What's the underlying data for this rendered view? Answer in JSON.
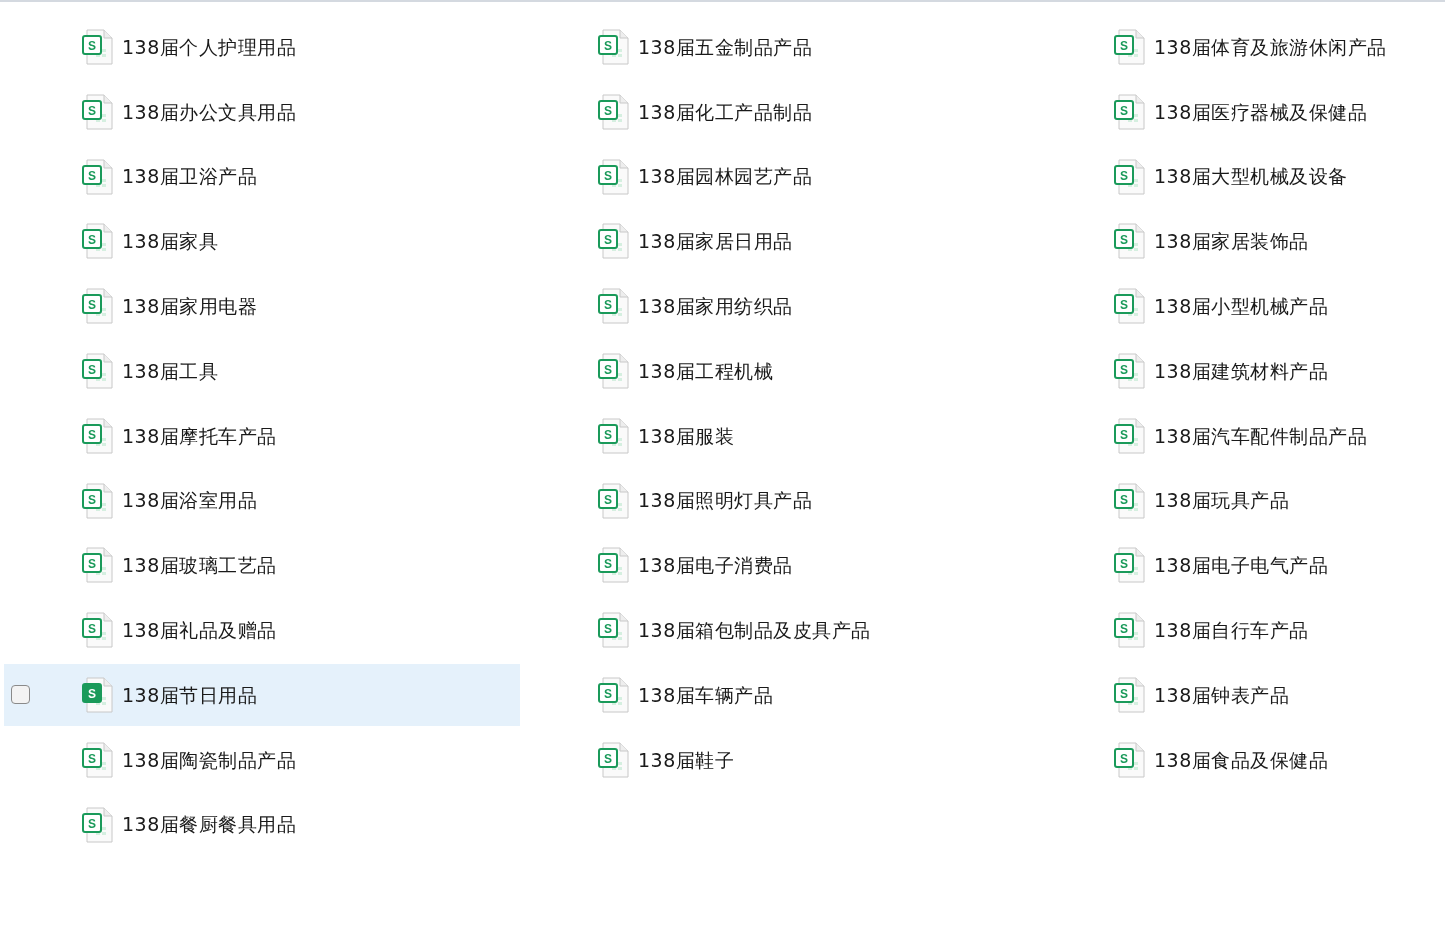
{
  "files": [
    {
      "icon_letter": "S",
      "name": "138届个人护理用品",
      "selected": false,
      "checked": false
    },
    {
      "icon_letter": "S",
      "name": "138届五金制品产品",
      "selected": false,
      "checked": false
    },
    {
      "icon_letter": "S",
      "name": "138届体育及旅游休闲产品",
      "selected": false,
      "checked": false
    },
    {
      "icon_letter": "S",
      "name": "138届办公文具用品",
      "selected": false,
      "checked": false
    },
    {
      "icon_letter": "S",
      "name": "138届化工产品制品",
      "selected": false,
      "checked": false
    },
    {
      "icon_letter": "S",
      "name": "138届医疗器械及保健品",
      "selected": false,
      "checked": false
    },
    {
      "icon_letter": "S",
      "name": "138届卫浴产品",
      "selected": false,
      "checked": false
    },
    {
      "icon_letter": "S",
      "name": "138届园林园艺产品",
      "selected": false,
      "checked": false
    },
    {
      "icon_letter": "S",
      "name": "138届大型机械及设备",
      "selected": false,
      "checked": false
    },
    {
      "icon_letter": "S",
      "name": "138届家具",
      "selected": false,
      "checked": false
    },
    {
      "icon_letter": "S",
      "name": "138届家居日用品",
      "selected": false,
      "checked": false
    },
    {
      "icon_letter": "S",
      "name": "138届家居装饰品",
      "selected": false,
      "checked": false
    },
    {
      "icon_letter": "S",
      "name": "138届家用电器",
      "selected": false,
      "checked": false
    },
    {
      "icon_letter": "S",
      "name": "138届家用纺织品",
      "selected": false,
      "checked": false
    },
    {
      "icon_letter": "S",
      "name": "138届小型机械产品",
      "selected": false,
      "checked": false
    },
    {
      "icon_letter": "S",
      "name": "138届工具",
      "selected": false,
      "checked": false
    },
    {
      "icon_letter": "S",
      "name": "138届工程机械",
      "selected": false,
      "checked": false
    },
    {
      "icon_letter": "S",
      "name": "138届建筑材料产品",
      "selected": false,
      "checked": false
    },
    {
      "icon_letter": "S",
      "name": "138届摩托车产品",
      "selected": false,
      "checked": false
    },
    {
      "icon_letter": "S",
      "name": "138届服装",
      "selected": false,
      "checked": false
    },
    {
      "icon_letter": "S",
      "name": "138届汽车配件制品产品",
      "selected": false,
      "checked": false
    },
    {
      "icon_letter": "S",
      "name": "138届浴室用品",
      "selected": false,
      "checked": false
    },
    {
      "icon_letter": "S",
      "name": "138届照明灯具产品",
      "selected": false,
      "checked": false
    },
    {
      "icon_letter": "S",
      "name": "138届玩具产品",
      "selected": false,
      "checked": false
    },
    {
      "icon_letter": "S",
      "name": "138届玻璃工艺品",
      "selected": false,
      "checked": false
    },
    {
      "icon_letter": "S",
      "name": "138届电子消费品",
      "selected": false,
      "checked": false
    },
    {
      "icon_letter": "S",
      "name": "138届电子电气产品",
      "selected": false,
      "checked": false
    },
    {
      "icon_letter": "S",
      "name": "138届礼品及赠品",
      "selected": false,
      "checked": false
    },
    {
      "icon_letter": "S",
      "name": "138届箱包制品及皮具产品",
      "selected": false,
      "checked": false
    },
    {
      "icon_letter": "S",
      "name": "138届自行车产品",
      "selected": false,
      "checked": false
    },
    {
      "icon_letter": "S",
      "name": "138届节日用品",
      "selected": true,
      "checked": false
    },
    {
      "icon_letter": "S",
      "name": "138届车辆产品",
      "selected": false,
      "checked": false
    },
    {
      "icon_letter": "S",
      "name": "138届钟表产品",
      "selected": false,
      "checked": false
    },
    {
      "icon_letter": "S",
      "name": "138届陶瓷制品产品",
      "selected": false,
      "checked": false
    },
    {
      "icon_letter": "S",
      "name": "138届鞋子",
      "selected": false,
      "checked": false
    },
    {
      "icon_letter": "S",
      "name": "138届食品及保健品",
      "selected": false,
      "checked": false
    },
    {
      "icon_letter": "S",
      "name": "138届餐厨餐具用品",
      "selected": false,
      "checked": false
    }
  ]
}
